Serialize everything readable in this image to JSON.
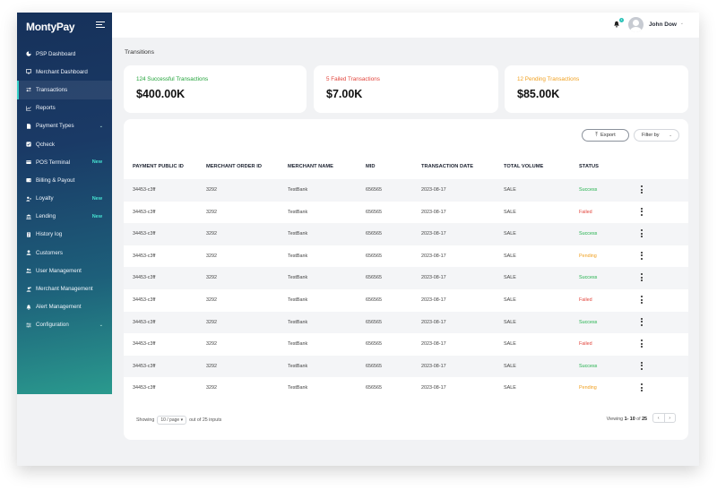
{
  "app": {
    "brand": "MontyPay"
  },
  "sidebar": {
    "items": [
      {
        "label": "PSP Dashboard",
        "icon": "pie-chart-icon",
        "badge": "",
        "chevron": false,
        "active": false
      },
      {
        "label": "Merchant Dashboard",
        "icon": "monitor-icon",
        "badge": "",
        "chevron": false,
        "active": false
      },
      {
        "label": "Transactions",
        "icon": "transfer-icon",
        "badge": "",
        "chevron": false,
        "active": true
      },
      {
        "label": "Reports",
        "icon": "line-chart-icon",
        "badge": "",
        "chevron": false,
        "active": false
      },
      {
        "label": "Payment Types",
        "icon": "document-icon",
        "badge": "",
        "chevron": true,
        "active": false
      },
      {
        "label": "Qcheck",
        "icon": "check-square-icon",
        "badge": "",
        "chevron": false,
        "active": false
      },
      {
        "label": "POS Terminal",
        "icon": "card-icon",
        "badge": "New",
        "chevron": false,
        "active": false
      },
      {
        "label": "Billing & Payout",
        "icon": "wallet-icon",
        "badge": "",
        "chevron": false,
        "active": false
      },
      {
        "label": "Loyalty",
        "icon": "user-plus-icon",
        "badge": "New",
        "chevron": false,
        "active": false
      },
      {
        "label": "Lending",
        "icon": "bank-icon",
        "badge": "New",
        "chevron": false,
        "active": false
      },
      {
        "label": "History log",
        "icon": "history-icon",
        "badge": "",
        "chevron": false,
        "active": false
      },
      {
        "label": "Customers",
        "icon": "user-icon",
        "badge": "",
        "chevron": false,
        "active": false
      },
      {
        "label": "User Management",
        "icon": "users-icon",
        "badge": "",
        "chevron": false,
        "active": false
      },
      {
        "label": "Merchant Management",
        "icon": "merchant-icon",
        "badge": "",
        "chevron": false,
        "active": false
      },
      {
        "label": "Alert Management",
        "icon": "bell-icon",
        "badge": "",
        "chevron": false,
        "active": false
      },
      {
        "label": "Configuration",
        "icon": "sliders-icon",
        "badge": "",
        "chevron": true,
        "active": false
      }
    ]
  },
  "header": {
    "user_name": "John Dow",
    "notification_count": "1"
  },
  "page": {
    "title": "Transitions"
  },
  "cards": [
    {
      "label": "124 Successful Transactions",
      "value": "$400.00K",
      "color": "#22a33a"
    },
    {
      "label": "5 Failed Transactions",
      "value": "$7.00K",
      "color": "#e2453c"
    },
    {
      "label": "12 Pending Transactions",
      "value": "$85.00K",
      "color": "#f0a020"
    }
  ],
  "toolbar": {
    "export_label": "Export",
    "filter_label": "Filter by"
  },
  "table": {
    "columns": [
      "PAYMENT PUBLIC ID",
      "MERCHANT ORDER ID",
      "MERCHANT NAME",
      "MID",
      "TRANSACTION DATE",
      "TOTAL VOLUME",
      "STATUS"
    ],
    "rows": [
      [
        "34453-c3ff",
        "3292",
        "TestBank",
        "656565",
        "2023-08-17",
        "SALE",
        "Success"
      ],
      [
        "34453-c3ff",
        "3292",
        "TestBank",
        "656565",
        "2023-08-17",
        "SALE",
        "Failed"
      ],
      [
        "34453-c3ff",
        "3292",
        "TestBank",
        "656565",
        "2023-08-17",
        "SALE",
        "Success"
      ],
      [
        "34453-c3ff",
        "3292",
        "TestBank",
        "656565",
        "2023-08-17",
        "SALE",
        "Pending"
      ],
      [
        "34453-c3ff",
        "3292",
        "TestBank",
        "656565",
        "2023-08-17",
        "SALE",
        "Success"
      ],
      [
        "34453-c3ff",
        "3292",
        "TestBank",
        "656565",
        "2023-08-17",
        "SALE",
        "Failed"
      ],
      [
        "34453-c3ff",
        "3292",
        "TestBank",
        "656565",
        "2023-08-17",
        "SALE",
        "Success"
      ],
      [
        "34453-c3ff",
        "3292",
        "TestBank",
        "656565",
        "2023-08-17",
        "SALE",
        "Failed"
      ],
      [
        "34453-c3ff",
        "3292",
        "TestBank",
        "656565",
        "2023-08-17",
        "SALE",
        "Success"
      ],
      [
        "34453-c3ff",
        "3292",
        "TestBank",
        "656565",
        "2023-08-17",
        "SALE",
        "Pending"
      ]
    ]
  },
  "pagination": {
    "showing_label": "Showing",
    "page_size": "10 / page",
    "out_of": "out of 25 inputs",
    "viewing_prefix": "Viewing",
    "viewing_range": "1- 10",
    "viewing_of": "of",
    "viewing_total": "25",
    "prev": "‹",
    "next": "›"
  }
}
